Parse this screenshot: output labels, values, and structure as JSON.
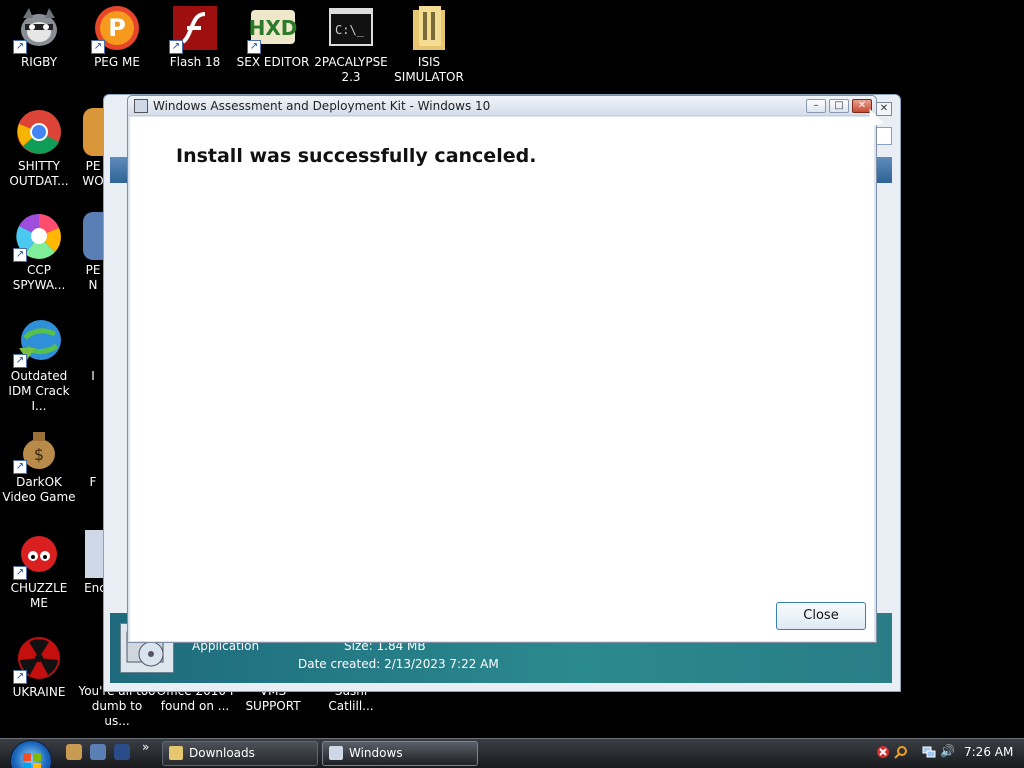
{
  "desktop": {
    "icons_col1": [
      {
        "label": "RIGBY",
        "icon": "raccoon-icon"
      },
      {
        "label": "SHITTY OUTDAT...",
        "icon": "chrome-icon"
      },
      {
        "label": "CCP SPYWA...",
        "icon": "pinwheel-icon"
      },
      {
        "label": "Outdated IDM Crack I...",
        "icon": "globe-download-icon"
      },
      {
        "label": "DarkOK Video Game",
        "icon": "money-bag-icon"
      },
      {
        "label": "CHUZZLE ME",
        "icon": "chuzzle-icon"
      },
      {
        "label": "UKRAINE",
        "icon": "radiation-icon"
      }
    ],
    "icons_top": [
      {
        "label": "PEG ME",
        "icon": "peggle-icon"
      },
      {
        "label": "Flash 18",
        "icon": "flash-icon"
      },
      {
        "label": "SEX EDITOR",
        "icon": "hxd-icon"
      },
      {
        "label": "2PACALYPSE 2.3",
        "icon": "terminal-icon"
      },
      {
        "label": "ISIS SIMULATOR",
        "icon": "folder-icon"
      }
    ],
    "bottom_partial": [
      {
        "label": "You're all too dumb to us..."
      },
      {
        "label": "Office 2010 I found on ..."
      },
      {
        "label": "VMS SUPPORT"
      },
      {
        "label": "Sushi Catlill..."
      }
    ],
    "col2_partial": [
      "PE",
      "WO",
      "PE",
      "N",
      "I",
      "F",
      "Enc"
    ]
  },
  "explorer_details": {
    "type": "Application",
    "size": "Size: 1.84 MB",
    "date_created": "Date created: 2/13/2023 7:22 AM"
  },
  "dialog": {
    "title": "Windows Assessment and Deployment Kit - Windows 10",
    "message": "Install was successfully canceled.",
    "close_button": "Close",
    "minimize": "–",
    "maximize": "□",
    "close": "✕"
  },
  "taskbar": {
    "tasks": [
      {
        "label": "Downloads"
      },
      {
        "label": "Windows Assessme..."
      }
    ],
    "chevron": "»",
    "clock": "7:26 AM"
  },
  "colors": {
    "desktop": "#000000",
    "titlebar_close": "#c74a32",
    "details_pane": "#2b8a8e"
  }
}
